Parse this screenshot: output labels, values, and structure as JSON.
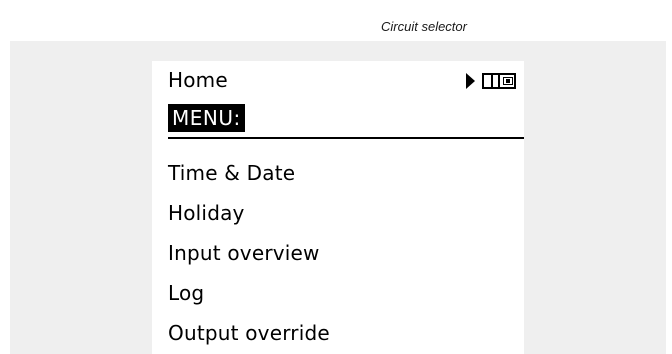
{
  "caption": "Circuit selector",
  "display": {
    "title": "Home",
    "section_label": "MENU:",
    "status_icons": [
      "play-icon",
      "circuit-selector-icon"
    ],
    "items": [
      {
        "label": "Time & Date"
      },
      {
        "label": "Holiday"
      },
      {
        "label": "Input overview"
      },
      {
        "label": "Log"
      },
      {
        "label": "Output override"
      }
    ]
  }
}
